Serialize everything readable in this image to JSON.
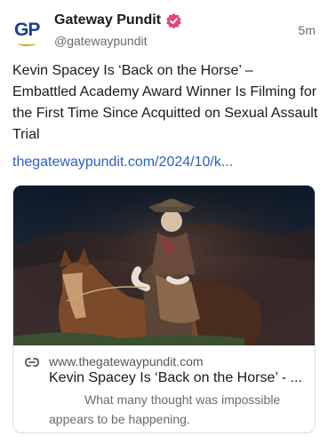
{
  "author": {
    "name": "Gateway Pundit",
    "handle": "@gatewaypundit",
    "avatar_text": "GP",
    "verified_icon": "verified-badge-icon"
  },
  "post": {
    "time": "5m",
    "text": "Kevin Spacey Is ‘Back on the Horse’ – Embattled Academy Award Winner Is Filming for the First Time Since Acquitted on Sexual Assault Trial",
    "link": "thegatewaypundit.com/2024/10/k..."
  },
  "card": {
    "domain": "www.thegatewaypundit.com",
    "title": "Kevin Spacey Is ‘Back on the Horse’ - ...",
    "description": "What many thought was impossible appears to be happening.",
    "link_icon": "link-icon"
  },
  "colors": {
    "brand_blue": "#1b3f8f",
    "link_blue": "#2b5fbf",
    "verified_pink": "#e0457b",
    "muted": "#6b6b6b"
  }
}
